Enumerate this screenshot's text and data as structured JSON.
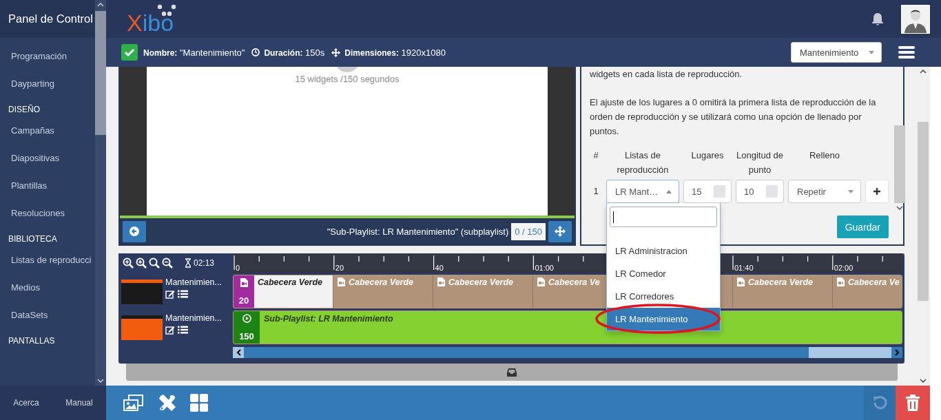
{
  "sidebar": {
    "title": "Panel de Control",
    "items": [
      {
        "kind": "link",
        "label": "Programación"
      },
      {
        "kind": "link",
        "label": "Dayparting"
      },
      {
        "kind": "heading",
        "label": "DISEÑO"
      },
      {
        "kind": "link",
        "label": "Campañas"
      },
      {
        "kind": "link",
        "label": "Diapositivas"
      },
      {
        "kind": "link",
        "label": "Plantillas"
      },
      {
        "kind": "link",
        "label": "Resoluciones"
      },
      {
        "kind": "heading",
        "label": "BIBLIOTECA"
      },
      {
        "kind": "link",
        "label": "Listas de reproducci"
      },
      {
        "kind": "link",
        "label": "Medios"
      },
      {
        "kind": "link",
        "label": "DataSets"
      },
      {
        "kind": "heading",
        "label": "PANTALLAS"
      }
    ],
    "footer": [
      "Acerca",
      "Manual"
    ]
  },
  "header": {
    "logo": "Xibo"
  },
  "layout_bar": {
    "name_label": "Nombre:",
    "name": "\"Mantenimiento\"",
    "duration_label": "Duración:",
    "duration": "150s",
    "dimensions_label": "Dimensiones:",
    "dimensions": "1920x1080",
    "layout_select": "Mantenimiento"
  },
  "viewer": {
    "info": "15 widgets /150 segundos",
    "caption": "\"Sub-Playlist: LR Mantenimiento\" (subplaylist)",
    "position": "0 / 150"
  },
  "properties": {
    "text_top": "widgets en cada lista de reproducción.",
    "text": "El ajuste de los lugares a 0 omitirá la primera lista de reproducción de la orden de reproducción y se utilizará como una opción de llenado por puntos.",
    "columns": [
      "#",
      "Listas de reproducción",
      "Lugares",
      "Longitud de punto",
      "Relleno"
    ],
    "rows": [
      {
        "index": "1",
        "playlist": "LR Mant…",
        "spots": "15",
        "spot_length": "10",
        "fill": "Repetir",
        "open": true
      }
    ],
    "save": "Guardar"
  },
  "dropdown": {
    "options": [
      {
        "label": "LR Administracion",
        "selected": false
      },
      {
        "label": "LR Comedor",
        "selected": false
      },
      {
        "label": "LR Corredores",
        "selected": false
      },
      {
        "label": "LR Mantenimiento",
        "selected": true
      }
    ]
  },
  "timeline": {
    "duration": "02:13",
    "ruler": [
      {
        "label": "0"
      },
      {
        "label": "20"
      },
      {
        "label": "40"
      },
      {
        "label": "01:00"
      },
      {
        "label": "01:40"
      },
      {
        "label": "02:00"
      }
    ],
    "tracks": [
      {
        "kind": "widgets",
        "name": "Mantenimien...",
        "widgets": [
          {
            "title": "Cabecera Verde",
            "duration": "20",
            "selected": true
          },
          {
            "title": "Cabecera Verde",
            "selected": false
          },
          {
            "title": "Cabecera Verde",
            "selected": false
          },
          {
            "title": "Cabecera Ve",
            "selected": false
          },
          {
            "selected": false
          },
          {
            "title": "Cabecera Verde",
            "selected": false
          },
          {
            "title": "Cabecera Ve",
            "selected": false
          }
        ]
      },
      {
        "kind": "subplaylist",
        "name": "Mantenimien...",
        "widgets": [
          {
            "title": "Sub-Playlist: LR Mantenimiento",
            "duration": "150"
          }
        ]
      }
    ]
  }
}
